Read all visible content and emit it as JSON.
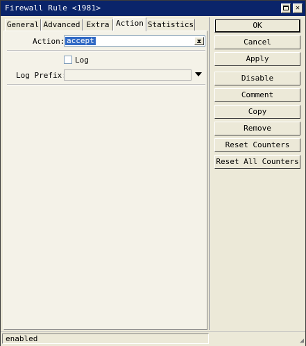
{
  "window": {
    "title": "Firewall Rule <1981>"
  },
  "tabs": [
    {
      "label": "General"
    },
    {
      "label": "Advanced"
    },
    {
      "label": "Extra"
    },
    {
      "label": "Action"
    },
    {
      "label": "Statistics"
    }
  ],
  "active_tab": "Action",
  "form": {
    "action_label": "Action:",
    "action_value": "accept",
    "log_label": "Log",
    "log_checked": false,
    "log_prefix_label": "Log Prefix:",
    "log_prefix_value": ""
  },
  "buttons": {
    "ok": "OK",
    "cancel": "Cancel",
    "apply": "Apply",
    "disable": "Disable",
    "comment": "Comment",
    "copy": "Copy",
    "remove": "Remove",
    "reset_counters": "Reset Counters",
    "reset_all_counters": "Reset All Counters"
  },
  "status": {
    "text": "enabled"
  },
  "colors": {
    "titlebar": "#0a246a",
    "selection": "#316ac5",
    "face": "#ece9d8"
  }
}
